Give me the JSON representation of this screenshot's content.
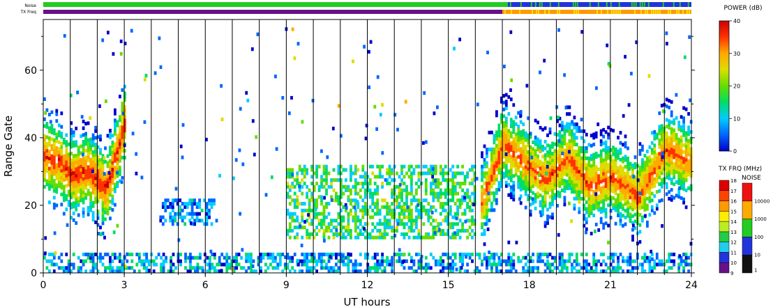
{
  "chart_data": {
    "type": "heatmap",
    "title": "",
    "xlabel": "UT hours",
    "ylabel": "Range Gate",
    "xlim": [
      0,
      24
    ],
    "ylim": [
      0,
      75
    ],
    "x_ticks": [
      "0",
      "3",
      "6",
      "9",
      "12",
      "15",
      "18",
      "21",
      "24"
    ],
    "y_ticks": [
      "0",
      "20",
      "40",
      "60"
    ],
    "vertical_gridlines_every_hours": 1,
    "status_bars": {
      "noise_label": "Noise",
      "txfreq_label": "TX Freq",
      "noise_segments": [
        {
          "from": 0,
          "to": 17.2,
          "color": "#22cc22"
        },
        {
          "from": 17.2,
          "to": 24,
          "color": "#2233dd",
          "speckle": "#22cc22"
        }
      ],
      "txfreq_segments": [
        {
          "from": 0,
          "to": 17.0,
          "color": "#661188"
        },
        {
          "from": 17.0,
          "to": 24,
          "color": "#ff9900",
          "speckle": "#ffdd00"
        }
      ]
    },
    "echo_regions": [
      {
        "name": "early-band",
        "x": [
          0,
          3.0
        ],
        "y_center": [
          34,
          32,
          28,
          30,
          24,
          38,
          48
        ],
        "profile_x": [
          0,
          0.6,
          1.1,
          1.6,
          2.3,
          2.8,
          3.1
        ],
        "power_dB": 38
      },
      {
        "name": "dawn-patch",
        "x": [
          4.3,
          6.4
        ],
        "y": [
          14,
          22
        ],
        "power_dB": 8
      },
      {
        "name": "mid-band",
        "x": [
          9.0,
          16.0
        ],
        "y": [
          10,
          32
        ],
        "power_dB": 16
      },
      {
        "name": "afternoon-band",
        "x": [
          16.2,
          24
        ],
        "y_center": [
          20,
          38,
          32,
          27,
          34,
          25,
          28,
          22,
          36,
          32
        ],
        "profile_x": [
          16.2,
          17.0,
          17.8,
          18.6,
          19.4,
          20.2,
          21.0,
          22.0,
          23.0,
          24
        ],
        "power_dB": 36
      },
      {
        "name": "near-range",
        "x": [
          0,
          24
        ],
        "y": [
          0,
          6
        ],
        "power_dB": 10
      }
    ],
    "power_colorbar": {
      "label": "POWER (dB)",
      "range": [
        0,
        40
      ],
      "ticks": [
        "0",
        "10",
        "20",
        "30",
        "40"
      ],
      "stops": [
        "#0000cc",
        "#0066ff",
        "#00ccff",
        "#00dd66",
        "#66dd00",
        "#dddd00",
        "#ffaa00",
        "#ff3300",
        "#cc0000"
      ]
    },
    "txfreq_colorbar": {
      "label": "TX FRQ (MHz)",
      "ticks": [
        "9",
        "10",
        "11",
        "12",
        "13",
        "14",
        "15",
        "16",
        "17",
        "18"
      ],
      "colors": [
        "#111111",
        "#661188",
        "#2233dd",
        "#22ccee",
        "#22cc44",
        "#bbee22",
        "#ffee00",
        "#ff9900",
        "#ff4400",
        "#dd0000"
      ]
    },
    "noise_colorbar": {
      "label": "NOISE",
      "ticks": [
        "1",
        "10",
        "100",
        "1000",
        "10000"
      ],
      "colors": [
        "#111111",
        "#2233dd",
        "#22cc22",
        "#ffaa00",
        "#ee1111"
      ]
    }
  }
}
